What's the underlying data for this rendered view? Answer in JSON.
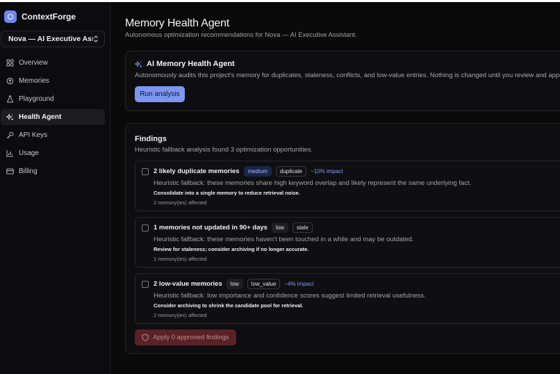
{
  "brand": {
    "name": "ContextForge",
    "accent": "#6f86f0"
  },
  "project": {
    "name": "Nova — AI Executive Assi..."
  },
  "nav": {
    "items": [
      {
        "label": "Overview",
        "icon": "grid-icon"
      },
      {
        "label": "Memories",
        "icon": "memory-icon"
      },
      {
        "label": "Playground",
        "icon": "flask-icon"
      },
      {
        "label": "Health Agent",
        "icon": "sparkles-icon",
        "active": true
      },
      {
        "label": "API Keys",
        "icon": "key-icon"
      },
      {
        "label": "Usage",
        "icon": "chart-icon"
      },
      {
        "label": "Billing",
        "icon": "card-icon"
      }
    ]
  },
  "page": {
    "title": "Memory Health Agent",
    "subtitle": "Autonomous optimization recommendations for Nova — AI Executive Assistant."
  },
  "agent": {
    "title": "AI Memory Health Agent",
    "description": "Autonomously audits this project's memory for duplicates, staleness, conflicts, and low-value entries. Nothing is changed until you review and approve fi",
    "run_label": "Run analysis",
    "button_color": "#7c96f2"
  },
  "findings": {
    "title": "Findings",
    "subtitle": "Heuristic fallback analysis found 3 optimization opportunities.",
    "items": [
      {
        "title": "2 likely duplicate memories",
        "severity": "medium",
        "type": "duplicate",
        "impact": "~10% impact",
        "description": "Heuristic fallback: these memories share high keyword overlap and likely represent the same underlying fact.",
        "action": "Consolidate into a single memory to reduce retrieval noise.",
        "affected": "2 memory(ies) affected"
      },
      {
        "title": "1 memories not updated in 90+ days",
        "severity": "low",
        "type": "stale",
        "impact": "",
        "description": "Heuristic fallback: these memories haven't been touched in a while and may be outdated.",
        "action": "Review for staleness; consider archiving if no longer accurate.",
        "affected": "1 memory(ies) affected"
      },
      {
        "title": "2 low-value memories",
        "severity": "low",
        "type": "low_value",
        "impact": "~4% impact",
        "description": "Heuristic fallback: low importance and confidence scores suggest limited retrieval usefulness.",
        "action": "Consider archiving to shrink the candidate pool for retrieval.",
        "affected": "2 memory(ies) affected"
      }
    ],
    "apply_label": "Apply 0 approved findings",
    "apply_color": "#5a2226"
  }
}
